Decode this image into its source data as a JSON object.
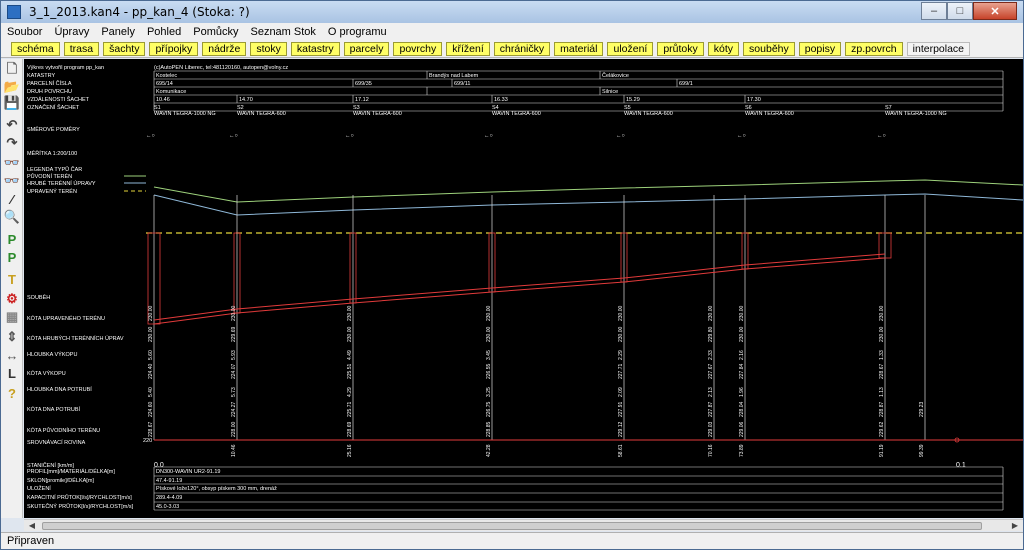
{
  "window": {
    "title": "3_1_2013.kan4 - pp_kan_4 (Stoka: ?)"
  },
  "titlebar_buttons": {
    "minimize": "–",
    "maximize": "□",
    "close": "✕"
  },
  "menu": [
    "Soubor",
    "Úpravy",
    "Panely",
    "Pohled",
    "Pomůcky",
    "Seznam Stok",
    "O programu"
  ],
  "tabs": [
    {
      "label": "schéma",
      "style": "yellow"
    },
    {
      "label": "trasa",
      "style": "yellow"
    },
    {
      "label": "šachty",
      "style": "yellow"
    },
    {
      "label": "přípojky",
      "style": "yellow"
    },
    {
      "label": "nádrže",
      "style": "yellow"
    },
    {
      "label": "stoky",
      "style": "yellow"
    },
    {
      "label": "katastry",
      "style": "yellow"
    },
    {
      "label": "parcely",
      "style": "yellow"
    },
    {
      "label": "povrchy",
      "style": "yellow"
    },
    {
      "label": "křížení",
      "style": "yellow"
    },
    {
      "label": "chráničky",
      "style": "yellow"
    },
    {
      "label": "materiál",
      "style": "yellow"
    },
    {
      "label": "uložení",
      "style": "yellow"
    },
    {
      "label": "průtoky",
      "style": "yellow"
    },
    {
      "label": "kóty",
      "style": "yellow"
    },
    {
      "label": "souběhy",
      "style": "yellow"
    },
    {
      "label": "popisy",
      "style": "yellow"
    },
    {
      "label": "zp.povrch",
      "style": "yellow"
    },
    {
      "label": "interpolace",
      "style": "plain"
    }
  ],
  "toolbar_icons": [
    "new-file-icon",
    "open-folder-icon",
    "save-icon",
    "undo-icon",
    "redo-icon",
    "glasses-icon",
    "glasses-alt-icon",
    "line-icon",
    "zoom-icon",
    "p-icon",
    "p-alt-icon",
    "t-icon",
    "gear-icon",
    "grid-icon",
    "export-icon",
    "link-icon",
    "l-icon",
    "help-icon"
  ],
  "toolbar_glyphs": [
    "🗋",
    "📂",
    "💾",
    "↶",
    "↷",
    "👓",
    "👓",
    "⁄",
    "🔍",
    "P",
    "P",
    "T",
    "⚙",
    "▦",
    "⇕",
    "↔",
    "L",
    "?"
  ],
  "header": {
    "producer_note": "Výkres vytvořil program pp_kan",
    "company": "(c)AutoPEN Liberec, tel:481120160, autopen@volny.cz",
    "rows": [
      {
        "label": "KATASTRY",
        "cells": [
          "Kostelec",
          "Brandýs nad Labem",
          "Čelákovice"
        ]
      },
      {
        "label": "PARCELNÍ ČÍSLA",
        "cells": [
          "695/14",
          "699/35",
          "699/11",
          "699/1"
        ]
      },
      {
        "label": "DRUH POVRCHU",
        "cells": [
          "Komunikace",
          "",
          "Silnice"
        ]
      },
      {
        "label": "VZDÁLENOSTI ŠACHET",
        "cells": [
          "10.46",
          "14.70",
          "17.12",
          "16.33",
          "15.29",
          "17.30"
        ]
      },
      {
        "label": "OZNAČENÍ ŠACHET",
        "cells": [
          "S1 WAVIN TEGRA-1000 NG",
          "S2 WAVIN TEGRA-600",
          "S3 WAVIN TEGRA-600",
          "S4 WAVIN TEGRA-600",
          "S5 WAVIN TEGRA-600",
          "S6 WAVIN TEGRA-600",
          "S7 WAVIN TEGRA-1000 NG"
        ]
      }
    ]
  },
  "left_labels": {
    "smerove_pomery": "SMĚROVÉ POMĚRY",
    "meritka": "MĚŘÍTKA 1:200/100",
    "legenda": "LEGENDA TYPŮ ČAR",
    "puvodni": "PŮVODNÍ TERÉN",
    "hrube": "HRUBÉ TERÉNNÍ ÚPRAVY",
    "upraveny": "UPRAVENÝ TERÉN",
    "soubeh": "SOUBĚH",
    "kota_upr": "KÓTA UPRAVENÉHO TERÉNU",
    "kota_hrub": "KÓTA HRUBÝCH TERÉNNÍCH ÚPRAV",
    "hloubka_vyk": "HLOUBKA VÝKOPU",
    "kota_vyk": "KÓTA VÝKOPU",
    "hloubka_dna": "HLOUBKA DNA POTRUBÍ",
    "kota_dna": "KÓTA DNA POTRUBÍ",
    "kota_puv": "KÓTA PŮVODNÍHO TERÉNU",
    "srovnavaci": "SROVNÁVACÍ ROVINA",
    "srovnavaci_value": "220",
    "staniceni": "STANIČENÍ [km/m]",
    "profil": "PROFIL[mm]/MATERIÁL/DÉLKA[m]",
    "sklon": "SKLON[promile]/DÉLKA[m]",
    "ulozeni": "ULOŽENÍ",
    "kapacitni": "KAPACITNÍ PRŮTOK[l/s]/RYCHLOST[m/s]",
    "skutecny": "SKUTEČNÝ PRŮTOK[l/s]/RYCHLOST[m/s]"
  },
  "bottom_values": {
    "start_km": "0.0",
    "end_km": "0.1",
    "profil": "DN300-WAVIN UR2-91.19",
    "sklon": "47.4-91.19",
    "ulozeni": "Pískové lože120°, obsyp pískem 300 mm, drenáž",
    "kapacitni": "289.4-4.09",
    "skutecny": "45.0-3.03"
  },
  "station_values": [
    {
      "kota_upr": "230.00",
      "kota_hrub": "230.00",
      "hloubka_vyk": "5.60",
      "kota_vyk": "224.40",
      "hloubka_dna": "5.40",
      "kota_dna": "224.60",
      "kota_puv": "228.67",
      "staniceni": ""
    },
    {
      "kota_upr": "230.00",
      "kota_hrub": "229.69",
      "hloubka_vyk": "5.93",
      "kota_vyk": "224.07",
      "hloubka_dna": "5.73",
      "kota_dna": "224.27",
      "kota_puv": "228.00",
      "staniceni": "10.46"
    },
    {
      "kota_upr": "230.00",
      "kota_hrub": "230.00",
      "hloubka_vyk": "4.49",
      "kota_vyk": "225.51",
      "hloubka_dna": "4.29",
      "kota_dna": "225.71",
      "kota_puv": "228.69",
      "staniceni": "25.16"
    },
    {
      "kota_upr": "230.00",
      "kota_hrub": "230.00",
      "hloubka_vyk": "3.45",
      "kota_vyk": "226.55",
      "hloubka_dna": "3.25",
      "kota_dna": "226.75",
      "kota_puv": "228.85",
      "staniceni": "42.28"
    },
    {
      "kota_upr": "230.00",
      "kota_hrub": "230.00",
      "hloubka_vyk": "2.29",
      "kota_vyk": "227.71",
      "hloubka_dna": "2.09",
      "kota_dna": "227.91",
      "kota_puv": "229.12",
      "staniceni": "58.61"
    },
    {
      "kota_upr": "230.00",
      "kota_hrub": "229.80",
      "hloubka_vyk": "2.33",
      "kota_vyk": "227.67",
      "hloubka_dna": "2.13",
      "kota_dna": "227.87",
      "kota_puv": "229.03",
      "staniceni": "70.16"
    },
    {
      "kota_upr": "230.00",
      "kota_hrub": "230.00",
      "hloubka_vyk": "2.16",
      "kota_vyk": "227.84",
      "hloubka_dna": "1.96",
      "kota_dna": "228.04",
      "kota_puv": "229.06",
      "staniceni": "73.89"
    },
    {
      "kota_upr": "230.00",
      "kota_hrub": "230.00",
      "hloubka_vyk": "1.33",
      "kota_vyk": "228.67",
      "hloubka_dna": "1.13",
      "kota_dna": "228.87",
      "kota_puv": "229.62",
      "staniceni": "91.19"
    },
    {
      "kota_upr": "",
      "kota_hrub": "",
      "hloubka_vyk": "",
      "kota_vyk": "",
      "hloubka_dna": "",
      "kota_dna": "229.23",
      "kota_puv": "",
      "staniceni": "99.39"
    }
  ],
  "status": "Připraven",
  "colors": {
    "terrain_green": "#9ed27c",
    "terrain_blue": "#8fb8d8",
    "design_yellow": "#e3d53a",
    "pipe_red": "#e23b3b",
    "tab_yellow": "#ffff66"
  }
}
